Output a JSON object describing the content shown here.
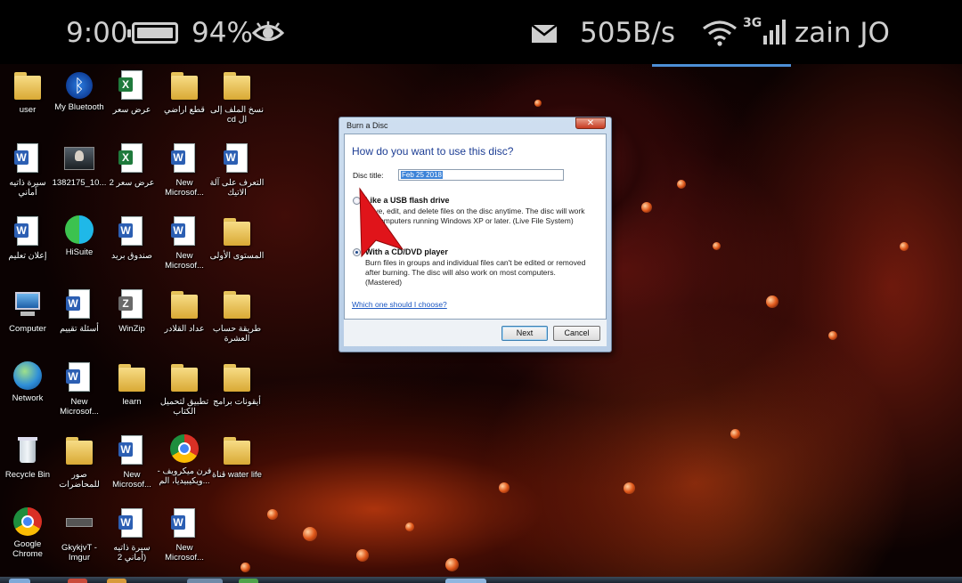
{
  "status_bar": {
    "time": "9:00",
    "battery": "94%",
    "net_speed": "505B/s",
    "network_type": "3G",
    "carrier": "zain JO",
    "icons": [
      "battery-icon",
      "eye-icon",
      "mail-icon",
      "wifi-icon",
      "signal-icon"
    ]
  },
  "desktop": {
    "icons": [
      {
        "label": "user",
        "icon": "folder-icon"
      },
      {
        "label": "My Bluetooth",
        "icon": "bluetooth-icon"
      },
      {
        "label": "عرض سعر",
        "icon": "excel-icon"
      },
      {
        "label": "قطع اراضي",
        "icon": "folder-icon"
      },
      {
        "label": "نسخ الملف إلى cd ال",
        "icon": "folder-icon"
      },
      {
        "label": "سيرة ذاتيه أماني",
        "icon": "word-doc-icon"
      },
      {
        "label": "1382175_10...",
        "icon": "photo-icon"
      },
      {
        "label": "عرض سعر 2",
        "icon": "excel-icon"
      },
      {
        "label": "New Microsof...",
        "icon": "word-doc-icon"
      },
      {
        "label": "التعرف على آلة الاتيك",
        "icon": "document-icon"
      },
      {
        "label": "إعلان تعليم",
        "icon": "word-doc-icon"
      },
      {
        "label": "HiSuite",
        "icon": "hisuite-icon"
      },
      {
        "label": "صندوق بريد",
        "icon": "word-doc-icon"
      },
      {
        "label": "New Microsof...",
        "icon": "word-doc-icon"
      },
      {
        "label": "المستوى الأولى",
        "icon": "folder-icon"
      },
      {
        "label": "Computer",
        "icon": "computer-icon"
      },
      {
        "label": "أسئلة تقييم",
        "icon": "word-doc-icon"
      },
      {
        "label": "WinZip",
        "icon": "winzip-icon"
      },
      {
        "label": "عداد القلادر",
        "icon": "folder-icon"
      },
      {
        "label": "طريقة حساب العشرة",
        "icon": "folder-icon"
      },
      {
        "label": "Network",
        "icon": "network-globe-icon"
      },
      {
        "label": "New Microsof...",
        "icon": "word-doc-icon"
      },
      {
        "label": "learn",
        "icon": "folder-icon"
      },
      {
        "label": "تطبيق لتحميل الكتاب",
        "icon": "folder-icon"
      },
      {
        "label": "أيقونات برامج",
        "icon": "folder-icon"
      },
      {
        "label": "Recycle Bin",
        "icon": "recycle-bin-icon"
      },
      {
        "label": "صور للمحاضرات",
        "icon": "folder-icon"
      },
      {
        "label": "New Microsof...",
        "icon": "word-doc-icon"
      },
      {
        "label": "فرن ميكرويف - ويكيبيديا، الم...",
        "icon": "chrome-icon"
      },
      {
        "label": "قناة water life",
        "icon": "folder-icon"
      },
      {
        "label": "Google Chrome",
        "icon": "chrome-icon"
      },
      {
        "label": "GkykjvT - Imgur",
        "icon": "image-file-icon"
      },
      {
        "label": "سيرة ذاتيه (أماني 2",
        "icon": "word-doc-icon"
      },
      {
        "label": "New Microsof...",
        "icon": "word-doc-icon"
      }
    ]
  },
  "dialog": {
    "window_title": "Burn a Disc",
    "close_glyph": "✕",
    "heading": "How do you want to use this disc?",
    "disc_title_label": "Disc title:",
    "disc_title_value": "Feb 25 2018",
    "option_usb": {
      "title": "Like a USB flash drive",
      "description": "Save, edit, and delete files on the disc anytime. The disc will work on computers running Windows XP or later. (Live File System)",
      "selected": false
    },
    "option_cd": {
      "title": "With a CD/DVD player",
      "description": "Burn files in groups and individual files can't be edited or removed after burning. The disc will also work on most computers. (Mastered)",
      "selected": true
    },
    "help_link": "Which one should I choose?",
    "next_label": "Next",
    "cancel_label": "Cancel"
  },
  "colors": {
    "dialog_heading": "#1c3d94",
    "link": "#1a56c2",
    "arrow": "#e0141a",
    "selection": "#3d84d8"
  }
}
